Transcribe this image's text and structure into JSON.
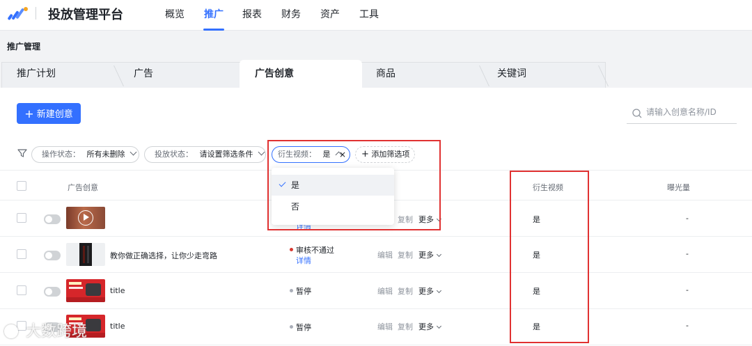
{
  "app": {
    "title": "投放管理平台"
  },
  "nav": {
    "items": [
      {
        "label": "概览"
      },
      {
        "label": "推广"
      },
      {
        "label": "报表"
      },
      {
        "label": "财务"
      },
      {
        "label": "资产"
      },
      {
        "label": "工具"
      }
    ],
    "active": "推广"
  },
  "breadcrumb": "推广管理",
  "tabs": [
    {
      "label": "推广计划"
    },
    {
      "label": "广告"
    },
    {
      "label": "广告创意"
    },
    {
      "label": "商品"
    },
    {
      "label": "关键词"
    }
  ],
  "active_tab": "广告创意",
  "toolbar": {
    "new_button": "新建创意",
    "search_placeholder": "请输入创意名称/ID"
  },
  "filters": [
    {
      "label": "操作状态：",
      "value": "所有未删除"
    },
    {
      "label": "投放状态：",
      "value": "请设置筛选条件"
    },
    {
      "label": "衍生视频：",
      "value": "是"
    }
  ],
  "add_filter": "添加筛选项",
  "dropdown": {
    "options": [
      {
        "label": "是",
        "selected": true
      },
      {
        "label": "否",
        "selected": false
      }
    ]
  },
  "table": {
    "columns": {
      "creative": "广告创意",
      "derivative": "衍生视频",
      "exposure": "曝光量"
    },
    "rows": [
      {
        "title": "",
        "status": "",
        "detail": "详情",
        "actions": [
          "复制",
          "更多"
        ],
        "derivative": "是",
        "exposure": "-"
      },
      {
        "title": "教你做正确选择，让你少走弯路",
        "status": "审核不通过",
        "status_color": "#d83931",
        "detail": "详情",
        "actions": [
          "编辑",
          "复制",
          "更多"
        ],
        "derivative": "是",
        "exposure": "-"
      },
      {
        "title": "title",
        "status": "暂停",
        "status_color": "#a9aeb8",
        "detail": "",
        "actions": [
          "编辑",
          "复制",
          "更多"
        ],
        "derivative": "是",
        "exposure": "-"
      },
      {
        "title": "title",
        "status": "暂停",
        "status_color": "#a9aeb8",
        "detail": "",
        "actions": [
          "编辑",
          "复制",
          "更多"
        ],
        "derivative": "是",
        "exposure": "-"
      }
    ]
  },
  "watermark": "大数跨境",
  "colors": {
    "accent": "#3370ff",
    "annotation": "#e03131",
    "rejected": "#d83931",
    "paused": "#a9aeb8"
  }
}
